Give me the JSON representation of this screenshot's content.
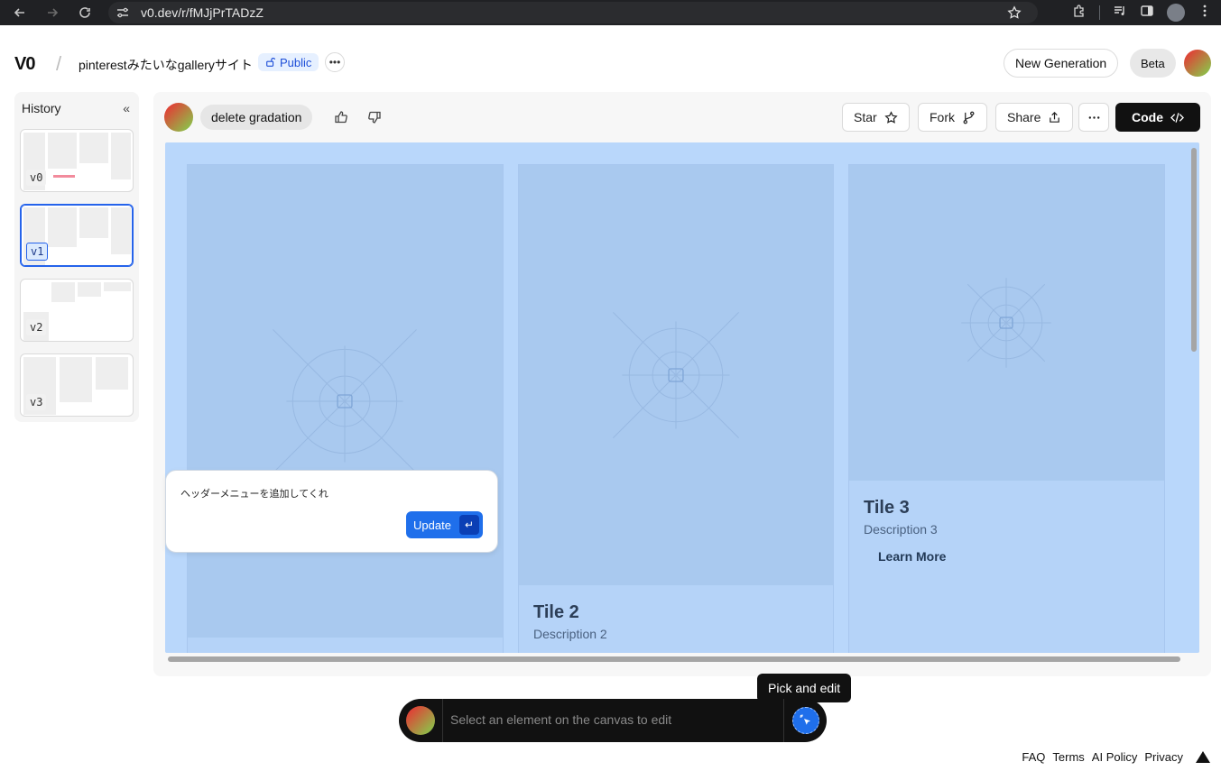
{
  "browser": {
    "url": "v0.dev/r/fMJjPrTADzZ"
  },
  "header": {
    "logo": "V0",
    "project_title": "pinterestみたいなgalleryサイト",
    "visibility": "Public",
    "new_generation": "New Generation",
    "beta": "Beta"
  },
  "history": {
    "title": "History",
    "versions": [
      "v0",
      "v1",
      "v2",
      "v3"
    ],
    "active_version": "v1"
  },
  "toolbar": {
    "prompt": "delete gradation",
    "star": "Star",
    "fork": "Fork",
    "share": "Share",
    "code": "Code"
  },
  "canvas": {
    "tiles": [
      {
        "title": "Tile 2",
        "description": "Description 2"
      },
      {
        "title": "Tile 3",
        "description": "Description 3",
        "link": "Learn More"
      }
    ],
    "background_color": "#b9d7fb"
  },
  "edit_popover": {
    "text": "ヘッダーメニューを追加してくれ",
    "button": "Update",
    "enter_key": "↵"
  },
  "bottom_bar": {
    "placeholder": "Select an element on the canvas to edit",
    "tooltip": "Pick and edit"
  },
  "footer": {
    "links": [
      "FAQ",
      "Terms",
      "AI Policy",
      "Privacy"
    ]
  },
  "colors": {
    "accent": "#1f6feb",
    "code_button": "#111111"
  }
}
